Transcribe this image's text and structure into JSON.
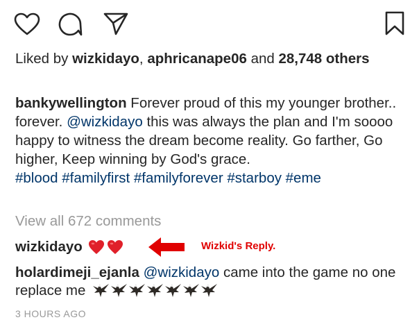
{
  "actions": {
    "like_icon": "heart-outline",
    "comment_icon": "speech-bubble",
    "share_icon": "paper-plane",
    "save_icon": "bookmark"
  },
  "likes": {
    "prefix": "Liked by ",
    "user1": "wizkidayo",
    "sep": ", ",
    "user2": "aphricanape06",
    "and": " and ",
    "count": "28,748 others"
  },
  "caption": {
    "username": "bankywellington",
    "text1": " Forever proud of this my younger brother.. forever. ",
    "mention": "@wizkidayo",
    "text2": " this was always the plan and I'm soooo happy to witness the dream become reality. Go farther, Go higher, Keep winning by God's grace.",
    "hashtags": "#blood #familyfirst #familyforever #starboy #eme"
  },
  "view_all": "View all 672 comments",
  "comments": [
    {
      "username": "wizkidayo",
      "emoji": "red-heart",
      "emoji_count": 2
    },
    {
      "username": "holardimeji_ejanla",
      "mention": "@wizkidayo",
      "text": " came into the game no one replace me",
      "emoji": "eagle",
      "emoji_count": 7
    }
  ],
  "annotation": {
    "label": "Wizkid's Reply.",
    "color": "#e00000"
  },
  "timestamp": "3 HOURS AGO",
  "colors": {
    "text": "#262626",
    "link": "#003569",
    "muted": "#999999"
  }
}
